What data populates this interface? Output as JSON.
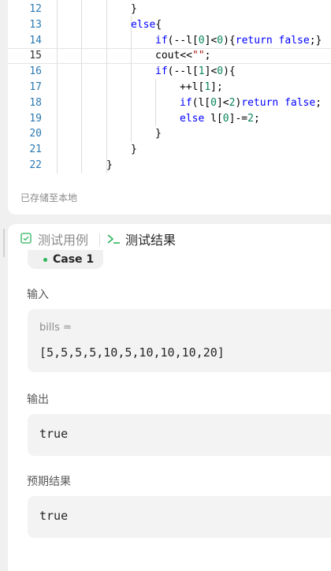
{
  "editor": {
    "line_numbers": [
      "12",
      "13",
      "14",
      "15",
      "16",
      "17",
      "18",
      "19",
      "20",
      "21",
      "22"
    ],
    "current_line": "15",
    "lines": [
      [
        {
          "t": "}",
          "c": "plain"
        }
      ],
      [
        {
          "t": "else",
          "c": "kw"
        },
        {
          "t": "{",
          "c": "plain"
        }
      ],
      [
        {
          "t": "if",
          "c": "kw"
        },
        {
          "t": "(--l[",
          "c": "plain"
        },
        {
          "t": "0",
          "c": "num"
        },
        {
          "t": "]<",
          "c": "plain"
        },
        {
          "t": "0",
          "c": "num"
        },
        {
          "t": "){",
          "c": "plain"
        },
        {
          "t": "return false",
          "c": "kw"
        },
        {
          "t": ";}",
          "c": "plain"
        }
      ],
      [
        {
          "t": "cout<<",
          "c": "plain"
        },
        {
          "t": "\"\"",
          "c": "str"
        },
        {
          "t": ";",
          "c": "plain"
        }
      ],
      [
        {
          "t": "if",
          "c": "kw"
        },
        {
          "t": "(--l[",
          "c": "plain"
        },
        {
          "t": "1",
          "c": "num"
        },
        {
          "t": "]<",
          "c": "plain"
        },
        {
          "t": "0",
          "c": "num"
        },
        {
          "t": "){",
          "c": "plain"
        }
      ],
      [
        {
          "t": "++l[",
          "c": "plain"
        },
        {
          "t": "1",
          "c": "num"
        },
        {
          "t": "];",
          "c": "plain"
        }
      ],
      [
        {
          "t": "if",
          "c": "kw"
        },
        {
          "t": "(l[",
          "c": "plain"
        },
        {
          "t": "0",
          "c": "num"
        },
        {
          "t": "]<",
          "c": "plain"
        },
        {
          "t": "2",
          "c": "num"
        },
        {
          "t": ")",
          "c": "plain"
        },
        {
          "t": "return false",
          "c": "kw"
        },
        {
          "t": ";",
          "c": "plain"
        }
      ],
      [
        {
          "t": "else",
          "c": "kw"
        },
        {
          "t": " l[",
          "c": "plain"
        },
        {
          "t": "0",
          "c": "num"
        },
        {
          "t": "]-=",
          "c": "plain"
        },
        {
          "t": "2",
          "c": "num"
        },
        {
          "t": ";",
          "c": "plain"
        }
      ],
      [
        {
          "t": "}",
          "c": "plain"
        }
      ],
      [
        {
          "t": "}",
          "c": "plain"
        }
      ],
      [
        {
          "t": "}",
          "c": "plain"
        }
      ]
    ],
    "saved_status": "已存储至本地"
  },
  "panel": {
    "tabs": [
      {
        "label": "测试用例",
        "icon": "checkbox-icon",
        "active": false
      },
      {
        "label": "测试结果",
        "icon": "terminal-icon",
        "active": true
      }
    ],
    "case_label": "Case 1",
    "case_status_color": "#2db55d",
    "input_label": "输入",
    "input_var": "bills =",
    "input_value": "[5,5,5,5,10,5,10,10,10,20]",
    "output_label": "输出",
    "output_value": "true",
    "expected_label": "预期结果",
    "expected_value": "true"
  }
}
